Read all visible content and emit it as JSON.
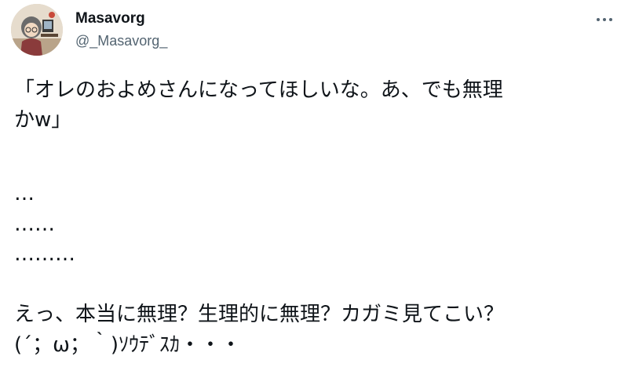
{
  "author": {
    "display_name": "Masavorg",
    "handle": "@_Masavorg_"
  },
  "icons": {
    "avatar": "avatar-illustration",
    "more": "more-options-icon"
  },
  "tweet": {
    "lines": [
      "「オレのおよめさんになってほしいな。あ、でも無理",
      "かw」",
      "…",
      "……",
      "………",
      "えっ、本当に無理？生理的に無理？カガミ見てこい？",
      "(´；ω；｀)ｿｳﾃﾞｽｶ・・・"
    ]
  },
  "colors": {
    "text": "#0f1419",
    "secondary": "#536471"
  }
}
